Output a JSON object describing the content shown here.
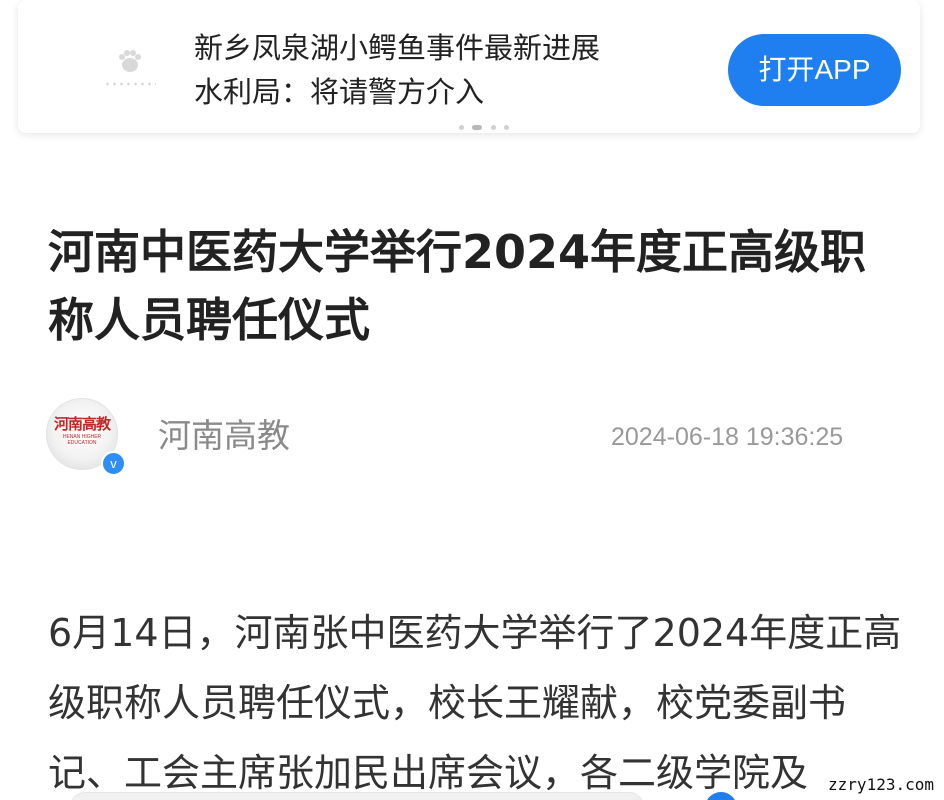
{
  "banner": {
    "headline_line1": "新乡凤泉湖小鳄鱼事件最新进展",
    "headline_line2": "水利局：将请警方介入",
    "thumbnail_icon": "paw-placeholder-icon",
    "open_app_label": "打开APP"
  },
  "article": {
    "title": "河南中医药大学举行2024年度正高级职称人员聘任仪式",
    "author": {
      "name": "河南高教",
      "avatar_text": "河南高教",
      "avatar_subtext": "HENAN HIGHER EDUCATION",
      "verified_mark": "v"
    },
    "published_at": "2024-06-18 19:36:25",
    "body": "6月14日，河南张中医药大学举行了2024年度正高级职称人员聘任仪式，校长王耀献，校党委副书记、工会主席张加民出席会议，各二级学院及"
  },
  "watermark": "zzry123.com",
  "colors": {
    "accent": "#1f7ff0",
    "title": "#222222",
    "meta": "#999999",
    "body": "#333333"
  }
}
